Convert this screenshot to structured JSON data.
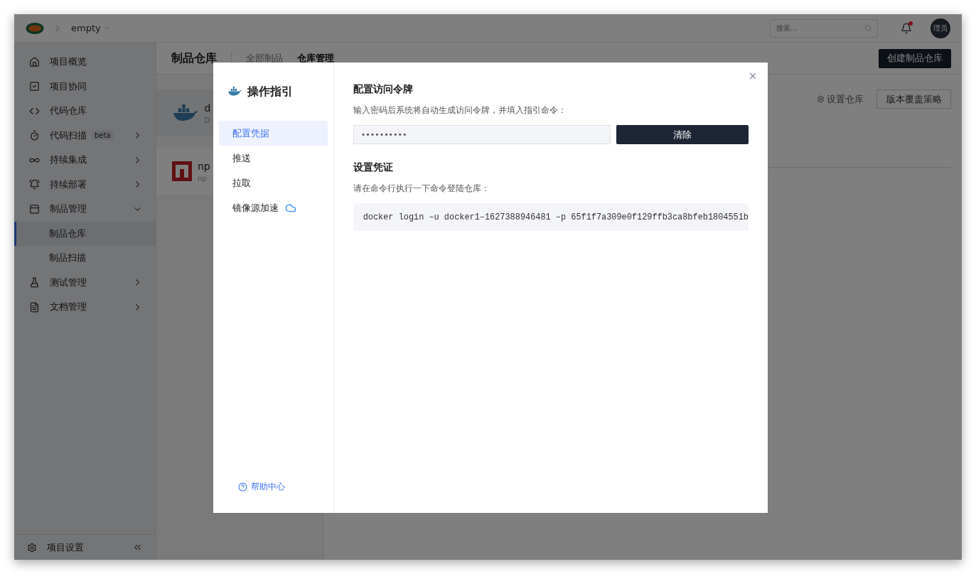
{
  "topbar": {
    "project": "empty",
    "search": {
      "placeholder": "搜索..."
    },
    "notification": {
      "unread": true
    },
    "avatar": "理员"
  },
  "sidebar": {
    "items": [
      {
        "kind": "link",
        "label": "项目概览",
        "selected": false
      },
      {
        "kind": "link",
        "label": "项目协同",
        "selected": false
      },
      {
        "kind": "link",
        "label": "代码仓库",
        "selected": false
      },
      {
        "kind": "group",
        "label": "代码扫描",
        "badge": "beta",
        "expanded": false,
        "selected": false
      },
      {
        "kind": "group",
        "label": "持续集成",
        "expanded": false,
        "selected": false
      },
      {
        "kind": "group",
        "label": "持续部署",
        "expanded": false,
        "selected": false
      },
      {
        "kind": "group",
        "label": "制品管理",
        "expanded": true,
        "selected": false,
        "children": [
          {
            "label": "制品仓库",
            "selected": true
          },
          {
            "label": "制品扫描",
            "selected": false
          }
        ]
      },
      {
        "kind": "group",
        "label": "测试管理",
        "expanded": false,
        "selected": false
      },
      {
        "kind": "group",
        "label": "文档管理",
        "expanded": false,
        "selected": false
      }
    ],
    "footer": {
      "label": "项目设置"
    }
  },
  "header": {
    "title": "制品仓库",
    "tabs": [
      {
        "label": "全部制品",
        "selected": false
      },
      {
        "label": "仓库管理",
        "selected": true
      }
    ],
    "create_button": "创建制品仓库"
  },
  "repos": [
    {
      "kind": "docker",
      "name": "d",
      "type": "D",
      "selected": true
    },
    {
      "kind": "npm",
      "name": "np",
      "type": "np",
      "selected": false
    }
  ],
  "repo_actions": {
    "settings": "设置仓库",
    "policy_button": "版本覆盖策略"
  },
  "dialog": {
    "title": "操作指引",
    "nav": [
      {
        "kind": "plain",
        "label": "配置凭据",
        "selected": true
      },
      {
        "kind": "plain",
        "label": "推送",
        "selected": false
      },
      {
        "kind": "plain",
        "label": "拉取",
        "selected": false
      },
      {
        "kind": "cloud",
        "label": "镜像源加速",
        "selected": false
      }
    ],
    "help": "帮助中心",
    "sections": [
      {
        "title": "配置访问令牌",
        "description": "输入密码后系统将自动生成访问令牌，并填入指引命令：",
        "password": {
          "value": "••••••••••"
        },
        "button": "清除"
      },
      {
        "title": "设置凭证",
        "description": "请在命令行执行一下命令登陆仓库：",
        "command": "docker login –u docker1–1627388946481 –p 65f1f7a309e0f129ffb3ca8bfeb1804551b"
      }
    ]
  }
}
